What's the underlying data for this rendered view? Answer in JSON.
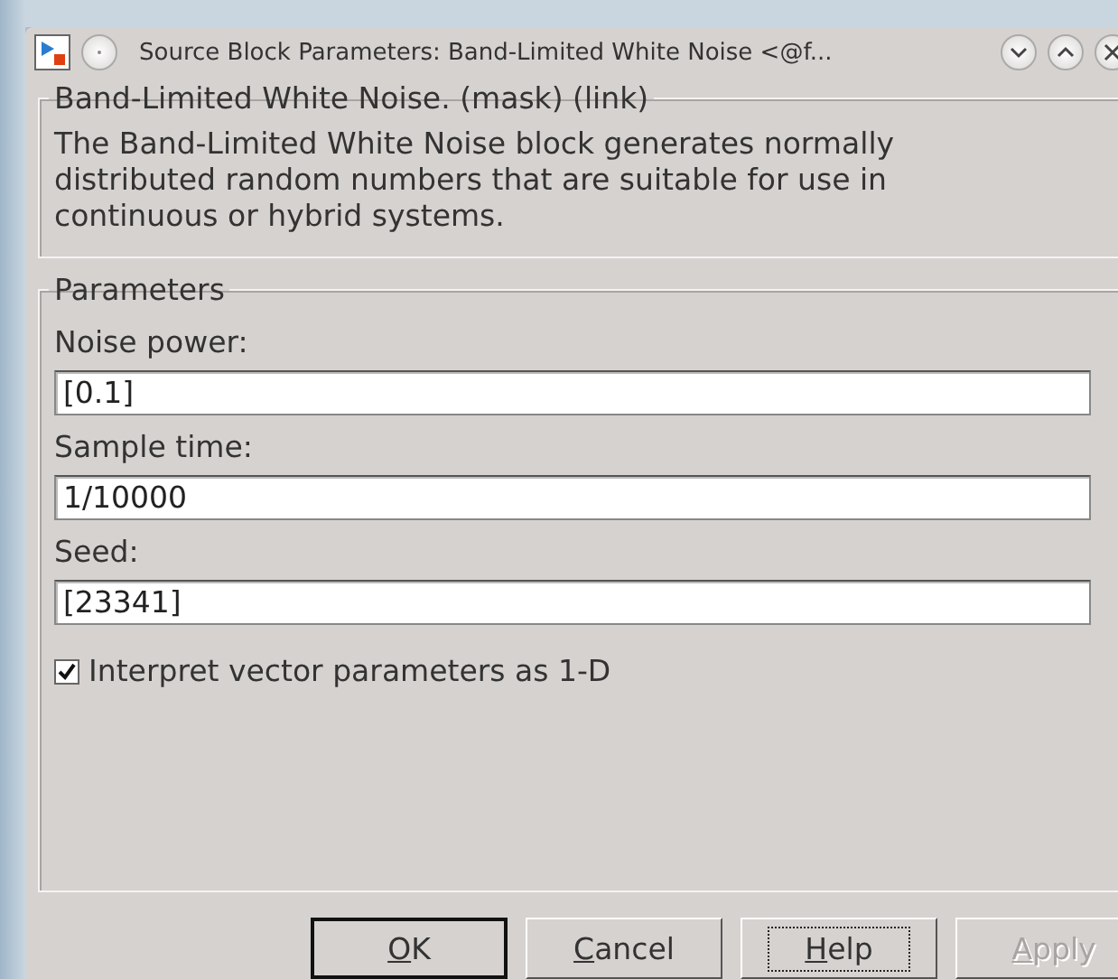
{
  "window": {
    "title": "Source Block Parameters: Band-Limited White Noise <@f..."
  },
  "description_group": {
    "title": "Band-Limited White Noise. (mask) (link)",
    "text": "The Band-Limited White Noise block generates normally distributed random numbers that are suitable for use in continuous or hybrid systems."
  },
  "parameters_group": {
    "title": "Parameters",
    "fields": [
      {
        "label": "Noise power:",
        "value": "[0.1]"
      },
      {
        "label": "Sample time:",
        "value": "1/10000"
      },
      {
        "label": "Seed:",
        "value": "[23341]"
      }
    ],
    "checkbox": {
      "label": "Interpret vector parameters as 1-D",
      "checked": true
    }
  },
  "buttons": [
    {
      "mnemonic": "O",
      "rest": "K",
      "focused": false,
      "disabled": false,
      "default": true
    },
    {
      "mnemonic": "C",
      "rest": "ancel",
      "focused": false,
      "disabled": false,
      "default": false
    },
    {
      "mnemonic": "H",
      "rest": "elp",
      "focused": true,
      "disabled": false,
      "default": false
    },
    {
      "mnemonic": "A",
      "rest": "pply",
      "focused": false,
      "disabled": true,
      "default": false
    }
  ]
}
